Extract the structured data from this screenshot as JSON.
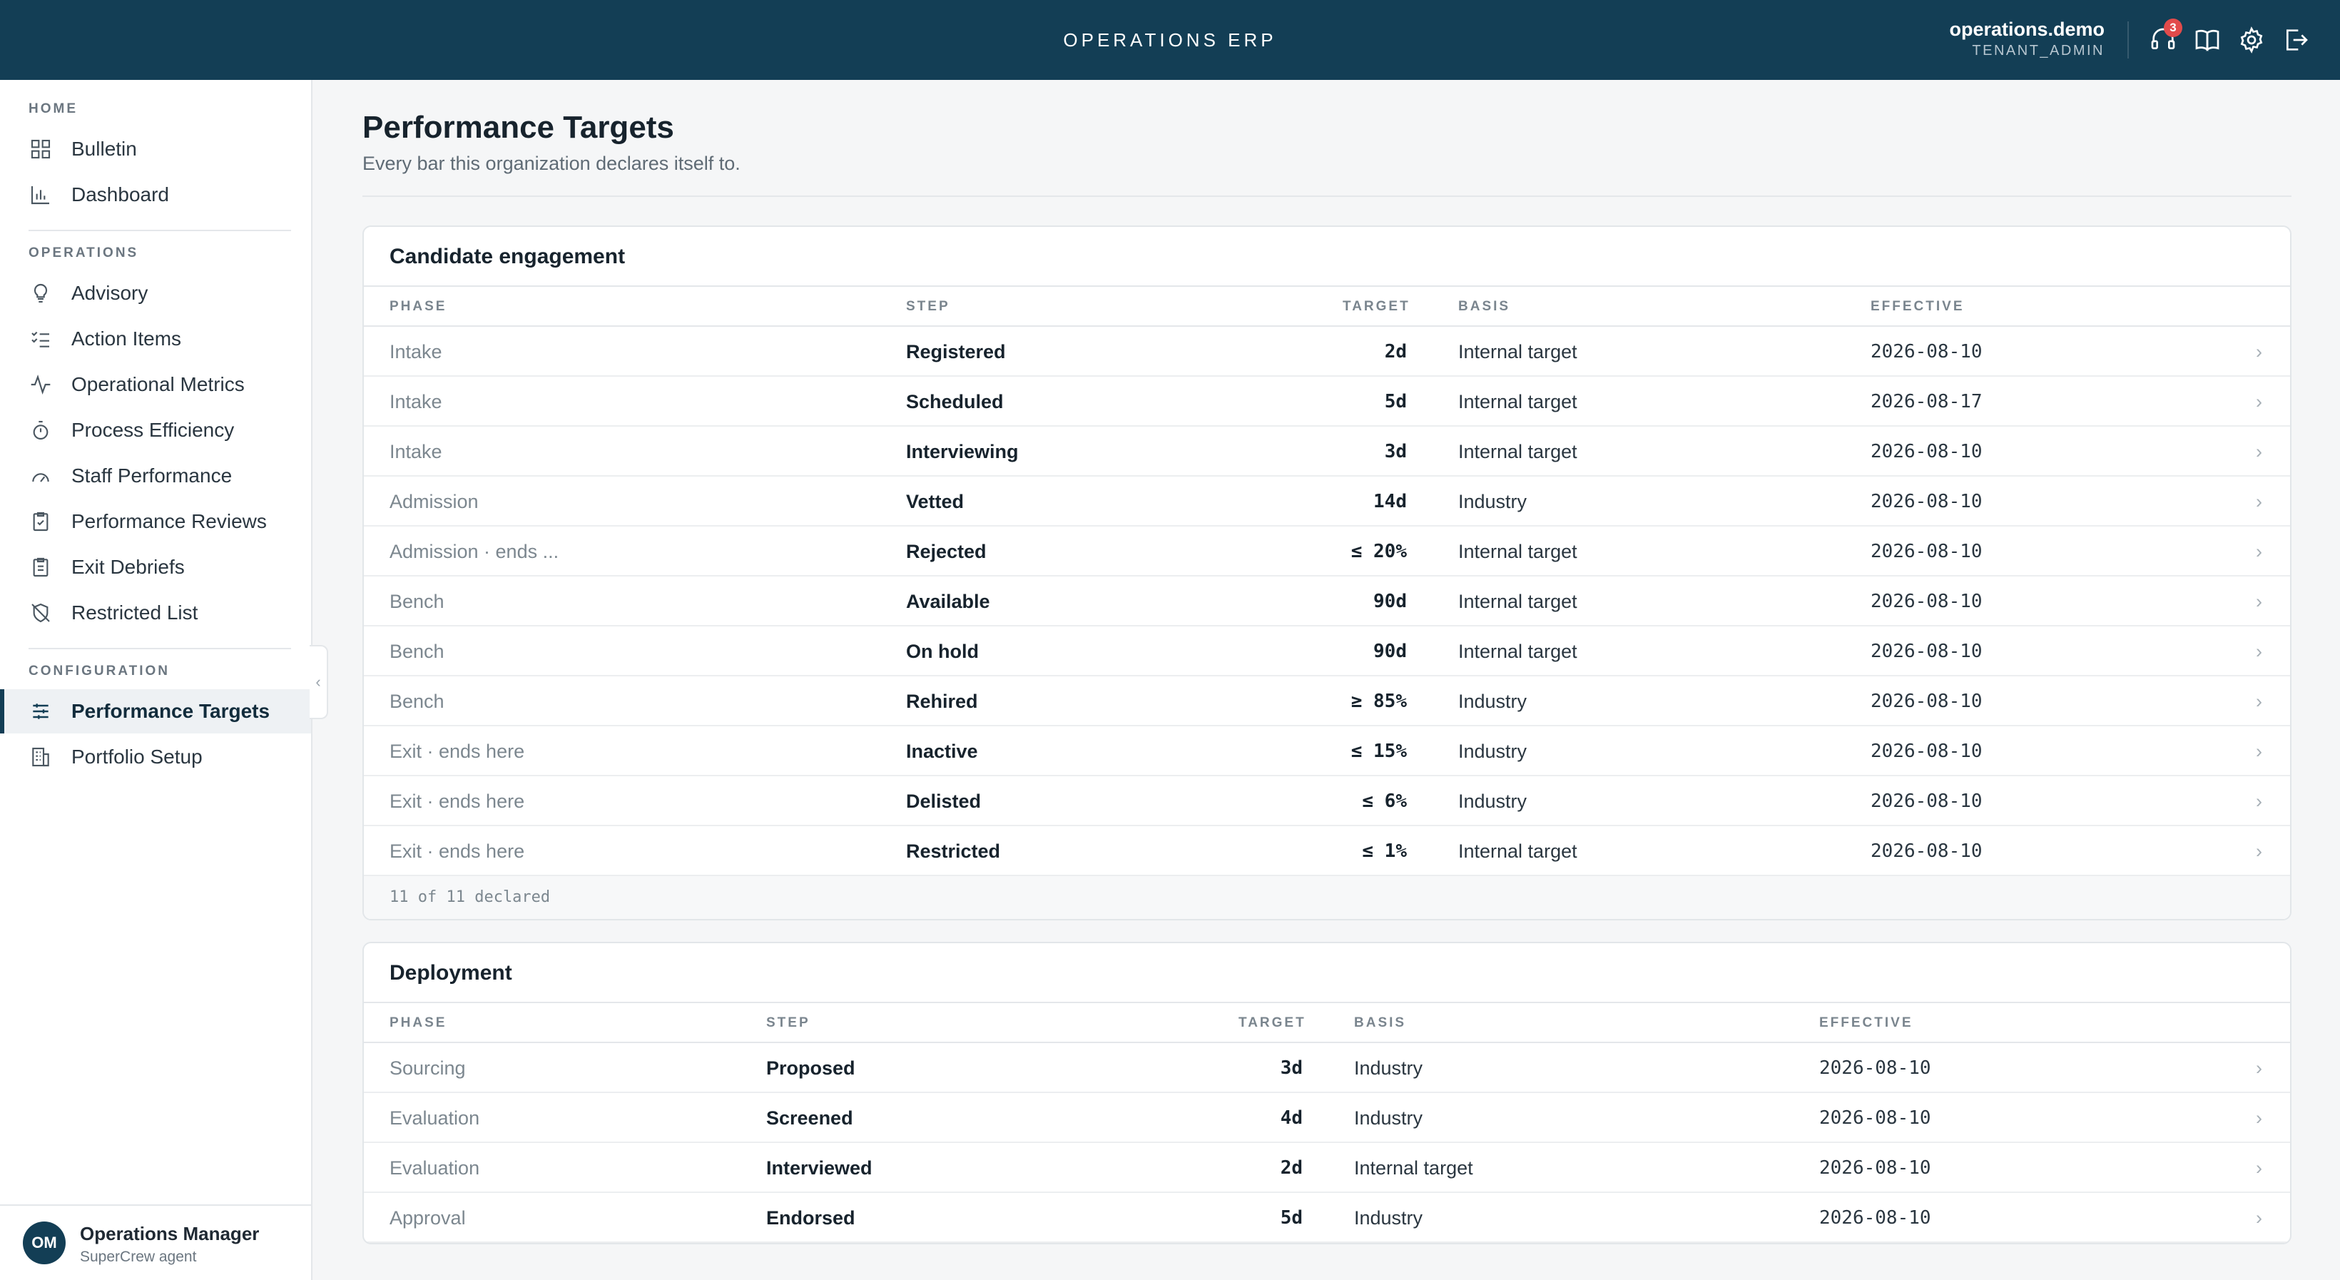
{
  "app": {
    "title": "OPERATIONS ERP",
    "user": "operations.demo",
    "role": "TENANT_ADMIN",
    "notifications": "3",
    "accent": "#133e55",
    "icons": [
      "headset-icon",
      "book-icon",
      "gear-icon",
      "logout-icon"
    ]
  },
  "sidebar": {
    "home_label": "HOME",
    "home_items": [
      {
        "label": "Bulletin",
        "icon": "grid-icon"
      },
      {
        "label": "Dashboard",
        "icon": "bar-chart-icon"
      }
    ],
    "operations_label": "OPERATIONS",
    "operations_items": [
      {
        "label": "Advisory",
        "icon": "lightbulb-icon"
      },
      {
        "label": "Action Items",
        "icon": "checklist-icon"
      },
      {
        "label": "Operational Metrics",
        "icon": "pulse-icon"
      },
      {
        "label": "Process Efficiency",
        "icon": "stopwatch-icon"
      },
      {
        "label": "Staff Performance",
        "icon": "gauge-icon"
      },
      {
        "label": "Performance Reviews",
        "icon": "clipboard-check-icon"
      },
      {
        "label": "Exit Debriefs",
        "icon": "clipboard-list-icon"
      },
      {
        "label": "Restricted List",
        "icon": "shield-off-icon"
      }
    ],
    "configuration_label": "CONFIGURATION",
    "configuration_items": [
      {
        "label": "Performance Targets",
        "icon": "sliders-icon",
        "active": true
      },
      {
        "label": "Portfolio Setup",
        "icon": "building-icon"
      }
    ],
    "footer": {
      "initials": "OM",
      "name": "Operations Manager",
      "subtitle": "SuperCrew agent"
    }
  },
  "page": {
    "title": "Performance Targets",
    "subtitle": "Every bar this organization declares itself to."
  },
  "columns": {
    "phase": "PHASE",
    "step": "STEP",
    "target": "TARGET",
    "basis": "BASIS",
    "effective": "EFFECTIVE"
  },
  "candidate": {
    "title": "Candidate engagement",
    "rows": [
      {
        "phase": "Intake",
        "step": "Registered",
        "target": "2d",
        "basis": "Internal target",
        "effective": "2026-08-10"
      },
      {
        "phase": "Intake",
        "step": "Scheduled",
        "target": "5d",
        "basis": "Internal target",
        "effective": "2026-08-17"
      },
      {
        "phase": "Intake",
        "step": "Interviewing",
        "target": "3d",
        "basis": "Internal target",
        "effective": "2026-08-10"
      },
      {
        "phase": "Admission",
        "step": "Vetted",
        "target": "14d",
        "basis": "Industry",
        "effective": "2026-08-10"
      },
      {
        "phase": "Admission · ends ...",
        "step": "Rejected",
        "target": "≤ 20%",
        "basis": "Internal target",
        "effective": "2026-08-10"
      },
      {
        "phase": "Bench",
        "step": "Available",
        "target": "90d",
        "basis": "Internal target",
        "effective": "2026-08-10"
      },
      {
        "phase": "Bench",
        "step": "On hold",
        "target": "90d",
        "basis": "Internal target",
        "effective": "2026-08-10"
      },
      {
        "phase": "Bench",
        "step": "Rehired",
        "target": "≥ 85%",
        "basis": "Industry",
        "effective": "2026-08-10"
      },
      {
        "phase": "Exit · ends here",
        "step": "Inactive",
        "target": "≤ 15%",
        "basis": "Industry",
        "effective": "2026-08-10"
      },
      {
        "phase": "Exit · ends here",
        "step": "Delisted",
        "target": "≤ 6%",
        "basis": "Industry",
        "effective": "2026-08-10"
      },
      {
        "phase": "Exit · ends here",
        "step": "Restricted",
        "target": "≤ 1%",
        "basis": "Internal target",
        "effective": "2026-08-10"
      }
    ],
    "footer": "11 of 11 declared"
  },
  "deployment": {
    "title": "Deployment",
    "rows": [
      {
        "phase": "Sourcing",
        "step": "Proposed",
        "target": "3d",
        "basis": "Industry",
        "effective": "2026-08-10"
      },
      {
        "phase": "Evaluation",
        "step": "Screened",
        "target": "4d",
        "basis": "Industry",
        "effective": "2026-08-10"
      },
      {
        "phase": "Evaluation",
        "step": "Interviewed",
        "target": "2d",
        "basis": "Internal target",
        "effective": "2026-08-10"
      },
      {
        "phase": "Approval",
        "step": "Endorsed",
        "target": "5d",
        "basis": "Industry",
        "effective": "2026-08-10"
      }
    ]
  }
}
